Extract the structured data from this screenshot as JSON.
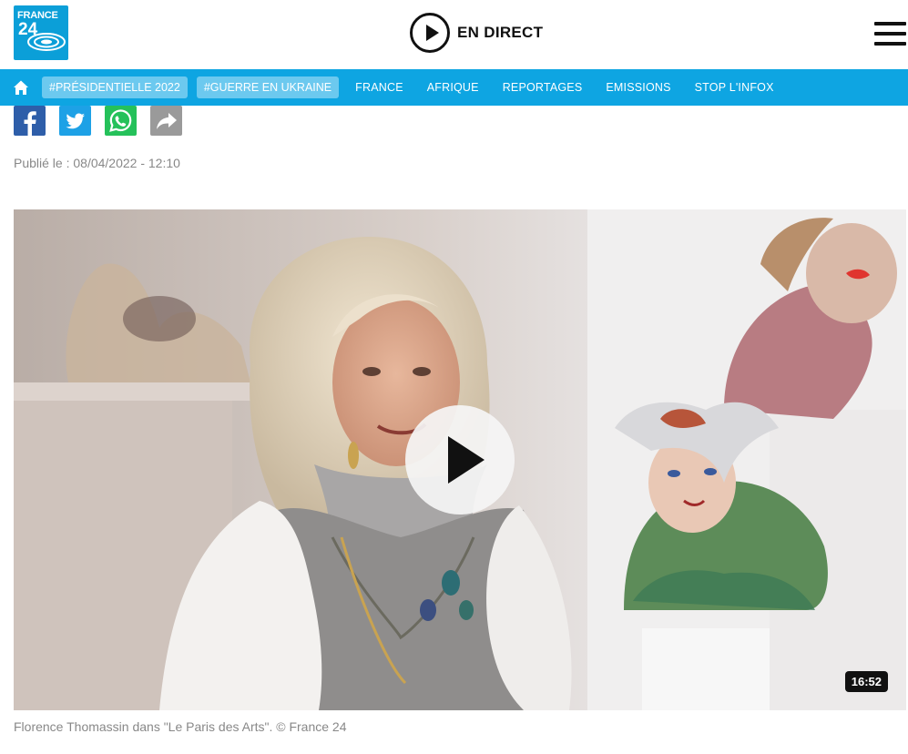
{
  "brand": {
    "logo_line1": "FRANCE",
    "logo_line2": "24",
    "color": "#0ea5e2"
  },
  "header": {
    "live_label": "EN DIRECT",
    "menu_icon": "hamburger-icon",
    "live_icon": "play-circle-icon"
  },
  "nav": {
    "home_icon": "home-icon",
    "tags": [
      "#PRÉSIDENTIELLE 2022",
      "#GUERRE EN UKRAINE"
    ],
    "items": [
      "FRANCE",
      "AFRIQUE",
      "REPORTAGES",
      "EMISSIONS",
      "STOP L'INFOX"
    ]
  },
  "share": {
    "icons": [
      "facebook-icon",
      "twitter-icon",
      "whatsapp-icon",
      "share-icon"
    ]
  },
  "article": {
    "published_label": "Publié le :",
    "published_date": "08/04/2022 - 12:10"
  },
  "video": {
    "duration": "16:52",
    "play_icon": "play-icon"
  },
  "caption": "Florence Thomassin dans \"Le Paris des Arts\". © France 24"
}
